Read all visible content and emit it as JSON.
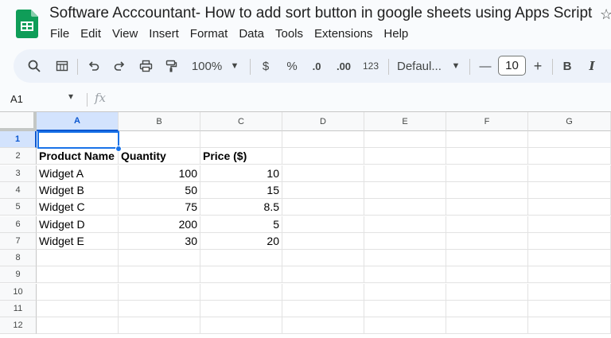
{
  "document": {
    "title": "Software Acccountant- How to add sort button in google sheets using Apps Script"
  },
  "menu": [
    "File",
    "Edit",
    "View",
    "Insert",
    "Format",
    "Data",
    "Tools",
    "Extensions",
    "Help"
  ],
  "toolbar": {
    "zoom": "100%",
    "currency": "$",
    "percent": "%",
    "decrease_decimal": ".0",
    "increase_decimal": ".00",
    "number_format": "123",
    "font": "Defaul...",
    "font_size": "10",
    "minus": "—",
    "plus": "+",
    "bold": "B",
    "italic": "I"
  },
  "formula_bar": {
    "cell_ref": "A1",
    "fx": "fx"
  },
  "columns": [
    "A",
    "B",
    "C",
    "D",
    "E",
    "F",
    "G"
  ],
  "rows": [
    "1",
    "2",
    "3",
    "4",
    "5",
    "6",
    "7",
    "8",
    "9",
    "10",
    "11",
    "12"
  ],
  "cells": {
    "A2": "Product Name",
    "B2": "Quantity",
    "C2": "Price ($)",
    "A3": "Widget A",
    "B3": "100",
    "C3": "10",
    "A4": "Widget B",
    "B4": "50",
    "C4": "15",
    "A5": "Widget C",
    "B5": "75",
    "C5": "8.5",
    "A6": "Widget D",
    "B6": "200",
    "C6": "5",
    "A7": "Widget E",
    "B7": "30",
    "C7": "20"
  },
  "selected_cell": "A1"
}
